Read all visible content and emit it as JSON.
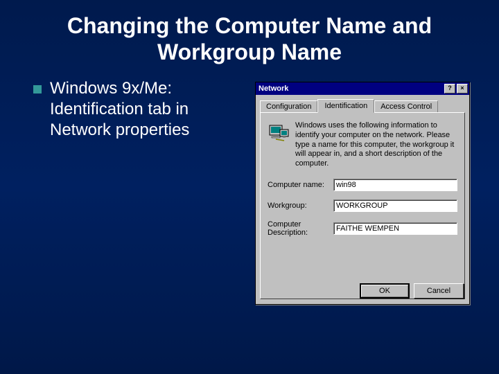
{
  "slide": {
    "title": "Changing the Computer Name and Workgroup Name",
    "bullet": "Windows 9x/Me: Identification tab in Network properties"
  },
  "dialog": {
    "title": "Network",
    "help_glyph": "?",
    "close_glyph": "×",
    "tabs": {
      "configuration": "Configuration",
      "identification": "Identification",
      "access_control": "Access Control"
    },
    "info_text": "Windows uses the following information to identify your computer on the network. Please type a name for this computer, the workgroup it will appear in, and a short description of the computer.",
    "fields": {
      "computer_name": {
        "label": "Computer name:",
        "value": "win98"
      },
      "workgroup": {
        "label": "Workgroup:",
        "value": "WORKGROUP"
      },
      "description": {
        "label": "Computer Description:",
        "value": "FAITHE WEMPEN"
      }
    },
    "buttons": {
      "ok": "OK",
      "cancel": "Cancel"
    }
  }
}
